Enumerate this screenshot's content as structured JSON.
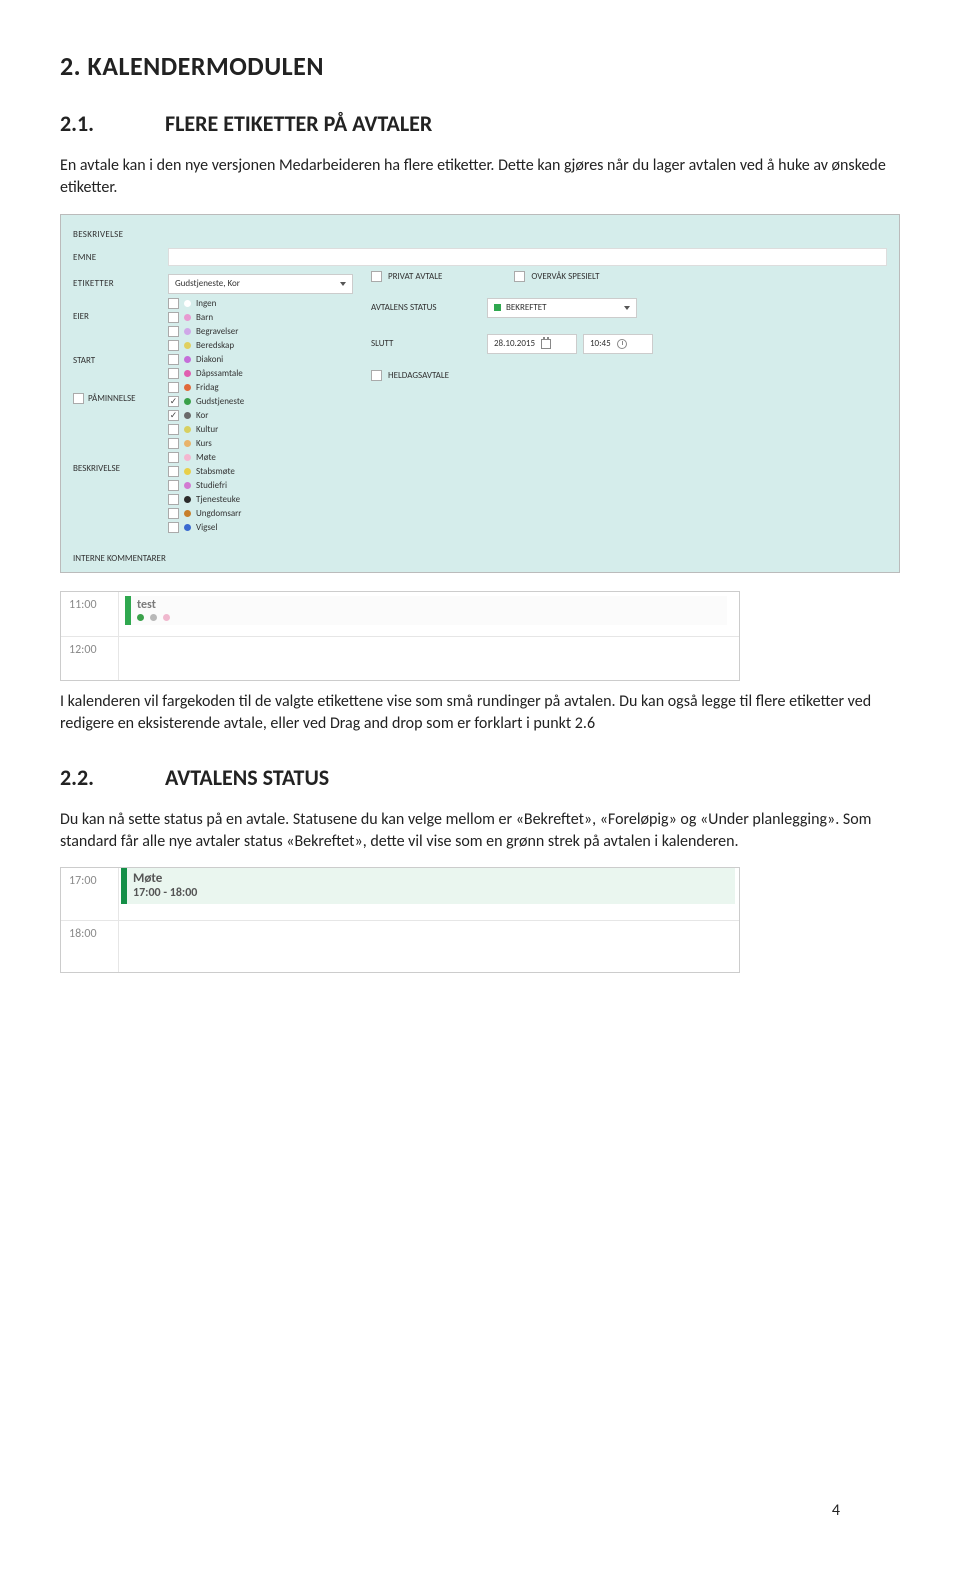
{
  "section_number": "2.",
  "section_title": "KALENDERMODULEN",
  "sub1_number": "2.1.",
  "sub1_title": "FLERE ETIKETTER PÅ AVTALER",
  "para1": "En avtale kan i den nye versjonen Medarbeideren ha flere etiketter. Dette kan gjøres når du lager avtalen ved å huke av ønskede etiketter.",
  "form": {
    "labels": {
      "beskrivelse": "BESKRIVELSE",
      "emne": "EMNE",
      "etiketter": "ETIKETTER",
      "eier": "EIER",
      "start": "START",
      "paminnelse": "PÅMINNELSE",
      "interne": "INTERNE KOMMENTARER",
      "privat": "PRIVAT AVTALE",
      "overvak": "OVERVÅK SPESIELT",
      "avtalens_status": "AVTALENS STATUS",
      "slutt": "SLUTT",
      "heldag": "HELDAGSAVTALE"
    },
    "etiketter_value": "Gudstjeneste, Kor",
    "status_value": "BEKREFTET",
    "slutt_date": "28.10.2015",
    "slutt_time": "10:45",
    "tags": [
      {
        "name": "Ingen",
        "color": "#ffffff"
      },
      {
        "name": "Barn",
        "color": "#e79ad1"
      },
      {
        "name": "Begravelser",
        "color": "#cfa8e8"
      },
      {
        "name": "Beredskap",
        "color": "#e0d060"
      },
      {
        "name": "Diakoni",
        "color": "#c56fd9"
      },
      {
        "name": "Dåpssamtale",
        "color": "#e05fb0"
      },
      {
        "name": "Fridag",
        "color": "#e06a3b"
      },
      {
        "name": "Gudstjeneste",
        "color": "#3aa14a",
        "checked": true
      },
      {
        "name": "Kor",
        "color": "#6a6a6a",
        "checked": true
      },
      {
        "name": "Kultur",
        "color": "#d8d060"
      },
      {
        "name": "Kurs",
        "color": "#e8b36a"
      },
      {
        "name": "Møte",
        "color": "#f4b7d0"
      },
      {
        "name": "Stabsmøte",
        "color": "#e8cf4a"
      },
      {
        "name": "Studiefri",
        "color": "#d27ad2"
      },
      {
        "name": "Tjenesteuke",
        "color": "#2b2b2b"
      },
      {
        "name": "Ungdomsarr",
        "color": "#c77f2b"
      },
      {
        "name": "Vigsel",
        "color": "#3a6ad0"
      }
    ]
  },
  "cal1": {
    "t1": "11:00",
    "t2": "12:00",
    "event_title": "test",
    "dots": [
      "#3aa14a",
      "#b8b8b8",
      "#f0b8ce"
    ]
  },
  "para2": "I kalenderen vil fargekoden til de valgte etikettene vise som små rundinger på avtalen. Du kan også legge til flere etiketter ved redigere en eksisterende avtale, eller ved Drag and drop som er forklart i punkt 2.6",
  "sub2_number": "2.2.",
  "sub2_title": "AVTALENS STATUS",
  "para3": "Du kan nå sette status på en avtale. Statusene du kan velge mellom er «Bekreftet», «Foreløpig» og «Under planlegging». Som standard får alle nye avtaler status «Bekreftet», dette vil vise som en grønn strek på avtalen i kalenderen.",
  "cal2": {
    "t1": "17:00",
    "t2": "18:00",
    "event_title": "Møte",
    "event_sub": "17:00 - 18:00"
  },
  "page_number": "4"
}
